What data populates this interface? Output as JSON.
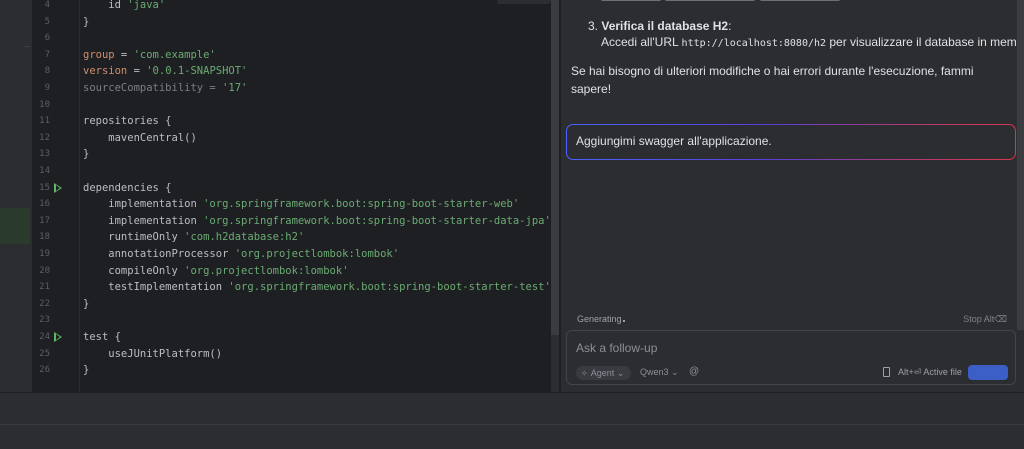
{
  "editor": {
    "lines": [
      {
        "n": "4",
        "run": false,
        "parts": [
          {
            "t": "    id ",
            "c": "kw"
          },
          {
            "t": "'java'",
            "c": "str"
          }
        ]
      },
      {
        "n": "5",
        "run": false,
        "parts": [
          {
            "t": "}",
            "c": "kw"
          }
        ]
      },
      {
        "n": "6",
        "run": false,
        "parts": []
      },
      {
        "n": "7",
        "run": false,
        "parts": [
          {
            "t": "group",
            "c": "prop"
          },
          {
            "t": " = ",
            "c": "kw"
          },
          {
            "t": "'com.example'",
            "c": "str"
          }
        ]
      },
      {
        "n": "8",
        "run": false,
        "parts": [
          {
            "t": "version",
            "c": "prop"
          },
          {
            "t": " = ",
            "c": "kw"
          },
          {
            "t": "'0.0.1-SNAPSHOT'",
            "c": "str"
          }
        ]
      },
      {
        "n": "9",
        "run": false,
        "parts": [
          {
            "t": "sourceCompatibility = ",
            "c": "dim"
          },
          {
            "t": "'17'",
            "c": "str"
          }
        ]
      },
      {
        "n": "10",
        "run": false,
        "parts": []
      },
      {
        "n": "11",
        "run": false,
        "parts": [
          {
            "t": "repositories {",
            "c": "kw"
          }
        ]
      },
      {
        "n": "12",
        "run": false,
        "parts": [
          {
            "t": "    mavenCentral()",
            "c": "kw"
          }
        ]
      },
      {
        "n": "13",
        "run": false,
        "parts": [
          {
            "t": "}",
            "c": "kw"
          }
        ]
      },
      {
        "n": "14",
        "run": false,
        "parts": []
      },
      {
        "n": "15",
        "run": true,
        "parts": [
          {
            "t": "dependencies {",
            "c": "kw"
          }
        ]
      },
      {
        "n": "16",
        "run": false,
        "parts": [
          {
            "t": "    implementation ",
            "c": "kw"
          },
          {
            "t": "'org.springframework.boot:spring-boot-starter-web'",
            "c": "str"
          }
        ]
      },
      {
        "n": "17",
        "run": false,
        "parts": [
          {
            "t": "    implementation ",
            "c": "kw"
          },
          {
            "t": "'org.springframework.boot:spring-boot-starter-data-jpa'",
            "c": "str"
          }
        ]
      },
      {
        "n": "18",
        "run": false,
        "parts": [
          {
            "t": "    runtimeOnly ",
            "c": "kw"
          },
          {
            "t": "'com.h2database:h2'",
            "c": "str"
          }
        ]
      },
      {
        "n": "19",
        "run": false,
        "parts": [
          {
            "t": "    annotationProcessor ",
            "c": "kw"
          },
          {
            "t": "'org.projectlombok:lombok'",
            "c": "str"
          }
        ]
      },
      {
        "n": "20",
        "run": false,
        "parts": [
          {
            "t": "    compileOnly ",
            "c": "kw"
          },
          {
            "t": "'org.projectlombok:lombok'",
            "c": "str"
          }
        ]
      },
      {
        "n": "21",
        "run": false,
        "parts": [
          {
            "t": "    testImplementation ",
            "c": "kw"
          },
          {
            "t": "'org.springframework.boot:spring-boot-starter-test'",
            "c": "str"
          }
        ]
      },
      {
        "n": "22",
        "run": false,
        "parts": [
          {
            "t": "}",
            "c": "kw"
          }
        ]
      },
      {
        "n": "23",
        "run": false,
        "parts": []
      },
      {
        "n": "24",
        "run": true,
        "parts": [
          {
            "t": "test {",
            "c": "kw"
          }
        ]
      },
      {
        "n": "25",
        "run": false,
        "parts": [
          {
            "t": "    useJUnitPlatform()",
            "c": "kw"
          }
        ]
      },
      {
        "n": "26",
        "run": false,
        "parts": [
          {
            "t": "}",
            "c": "kw"
          }
        ]
      }
    ]
  },
  "chat": {
    "step3_number": "3.",
    "step3_title": "Verifica il database H2",
    "step3_colon": ":",
    "step3_prefix": "Accedi all'URL ",
    "step3_url": "http://localhost:8080/h2",
    "step3_suffix": " per visualizzare il database in memoria.",
    "closing": "Se hai bisogno di ulteriori modifiche o hai errori durante l'esecuzione, fammi sapere!",
    "user_prompt": "Aggiungimi swagger all'applicazione.",
    "status": "Generating",
    "stop_label": "Stop",
    "stop_shortcut": "Alt⌫",
    "input_placeholder": "Ask a follow-up",
    "mode_label": "Agent",
    "mode_icon": "agent-icon",
    "model_label": "Qwen3",
    "model_chevron": "⌄",
    "mention_icon": "@",
    "active_file_shortcut": "Alt+⏎",
    "active_file_label": "Active file"
  },
  "colors": {
    "editor_bg": "#1e1f22",
    "panel_bg": "#2b2d30",
    "string": "#6aab73",
    "property": "#cf8e6d",
    "run_icon": "#5fb865",
    "send_button": "#3b5fc4"
  }
}
